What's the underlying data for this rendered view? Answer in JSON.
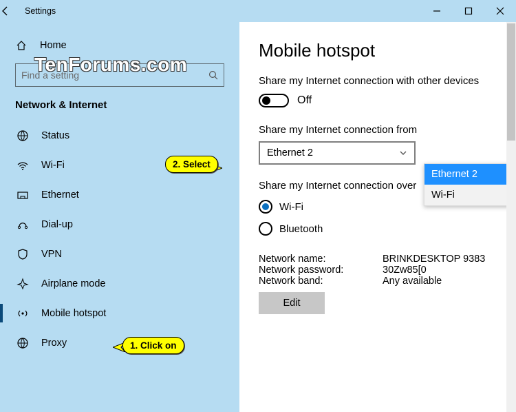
{
  "titlebar": {
    "title": "Settings"
  },
  "sidebar": {
    "home": "Home",
    "search_placeholder": "Find a setting",
    "section": "Network & Internet",
    "items": [
      {
        "label": "Status"
      },
      {
        "label": "Wi-Fi"
      },
      {
        "label": "Ethernet"
      },
      {
        "label": "Dial-up"
      },
      {
        "label": "VPN"
      },
      {
        "label": "Airplane mode"
      },
      {
        "label": "Mobile hotspot"
      },
      {
        "label": "Proxy"
      }
    ]
  },
  "content": {
    "heading": "Mobile hotspot",
    "share_label": "Share my Internet connection with other devices",
    "toggle_state": "Off",
    "from_label": "Share my Internet connection from",
    "from_selected": "Ethernet 2",
    "from_options": [
      "Ethernet 2",
      "Wi-Fi"
    ],
    "over_label": "Share my Internet connection over",
    "over_options": {
      "wifi": "Wi-Fi",
      "bt": "Bluetooth"
    },
    "net": {
      "name_k": "Network name:",
      "name_v": "BRINKDESKTOP 9383",
      "pass_k": "Network password:",
      "pass_v": "30Zw85[0",
      "band_k": "Network band:",
      "band_v": "Any available"
    },
    "edit": "Edit"
  },
  "callouts": {
    "c1": "1. Click on",
    "c2": "2. Select"
  },
  "watermark": "TenForums.com"
}
